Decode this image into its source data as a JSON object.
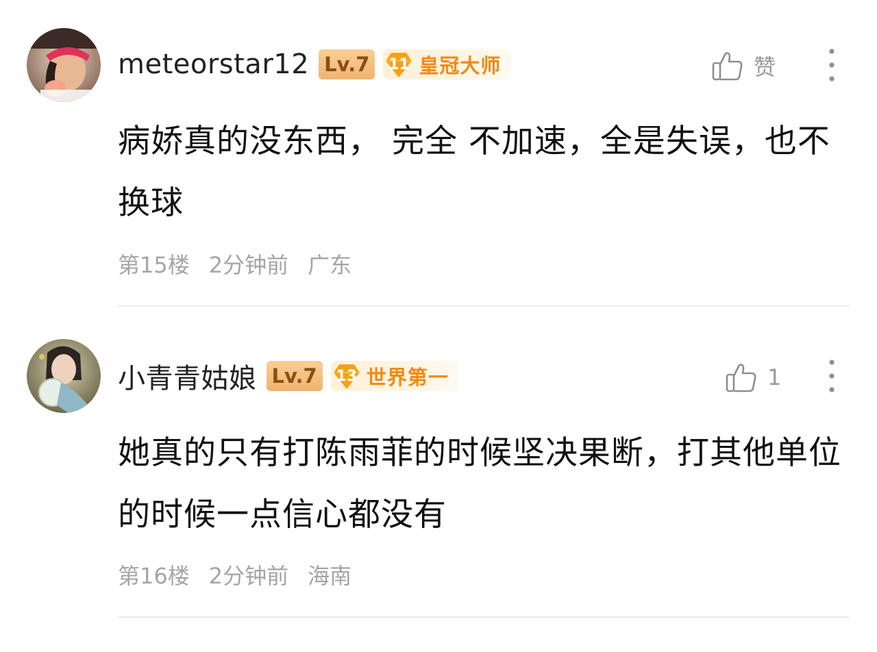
{
  "comments": [
    {
      "username": "meteorstar12",
      "level": "Lv.7",
      "rank_number": "11",
      "rank_title": "皇冠大师",
      "like_text": "赞",
      "content": "病娇真的没东西， 完全 不加速，全是失误，也不换球",
      "floor": "第15楼",
      "time": "2分钟前",
      "location": "广东"
    },
    {
      "username": "小青青姑娘",
      "level": "Lv.7",
      "rank_number": "13",
      "rank_title": "世界第一",
      "like_text": "1",
      "content": "她真的只有打陈雨菲的时候坚决果断，打其他单位的时候一点信心都没有",
      "floor": "第16楼",
      "time": "2分钟前",
      "location": "海南"
    }
  ],
  "colors": {
    "rank_orange": "#f5a21b",
    "rank_text": "#f08a16",
    "level_badge": "#f1b270",
    "meta_gray": "#a5a5a5",
    "divider": "#ececec"
  },
  "icons": [
    "avatar-photo",
    "thumbs-up-icon",
    "more-vertical-icon",
    "rank-diamond-icon"
  ]
}
